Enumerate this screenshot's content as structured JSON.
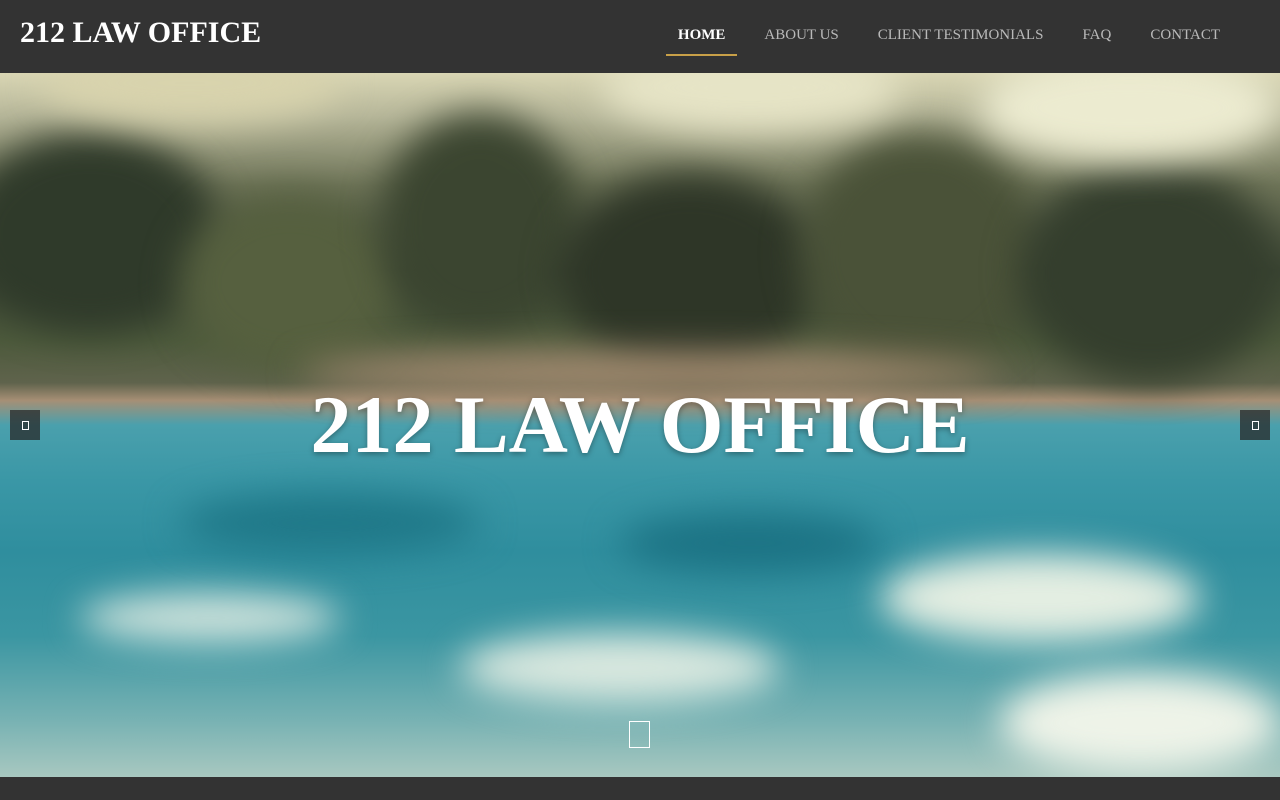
{
  "header": {
    "brand": "212 LAW OFFICE",
    "nav": [
      {
        "label": "HOME",
        "active": true
      },
      {
        "label": "ABOUT US",
        "active": false
      },
      {
        "label": "CLIENT TESTIMONIALS",
        "active": false
      },
      {
        "label": "FAQ",
        "active": false
      },
      {
        "label": "CONTACT",
        "active": false
      }
    ]
  },
  "hero": {
    "title": "212 LAW OFFICE",
    "prev_icon": "chevron-left-icon",
    "next_icon": "chevron-right-icon",
    "scroll_icon": "scroll-down-icon"
  },
  "colors": {
    "header_bg": "#333333",
    "nav_text": "#b9b9b9",
    "nav_active_text": "#ffffff",
    "nav_active_underline": "#c8a048",
    "hero_title": "#ffffff"
  }
}
